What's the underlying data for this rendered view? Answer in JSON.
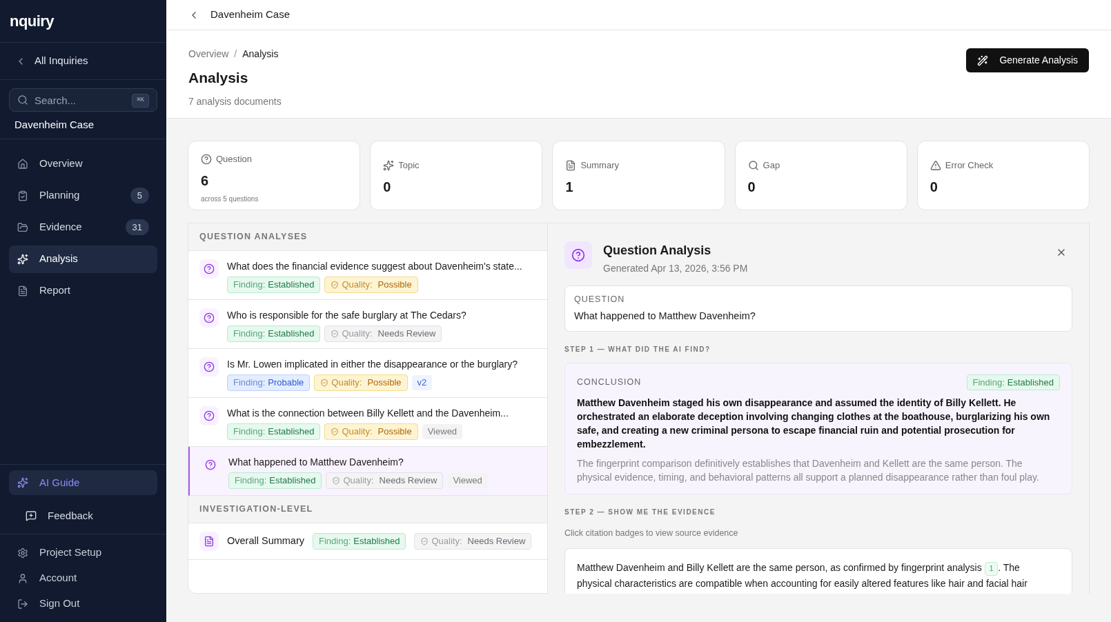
{
  "sidebar": {
    "logo": "nquiry",
    "back_link": "All Inquiries",
    "search": {
      "placeholder": "Search...",
      "shortcut": "⌘K"
    },
    "case_name": "Davenheim Case",
    "nav": [
      {
        "kind": "home",
        "label": "Overview",
        "selected": false
      },
      {
        "kind": "clipboard",
        "label": "Planning",
        "count": "5",
        "selected": false
      },
      {
        "kind": "folder",
        "label": "Evidence",
        "count": "31",
        "selected": false
      },
      {
        "kind": "sparkles",
        "label": "Analysis",
        "selected": true
      },
      {
        "kind": "file",
        "label": "Report",
        "selected": false
      }
    ],
    "ai_guide": "AI Guide",
    "feedback": "Feedback",
    "footer": [
      {
        "kind": "gear",
        "label": "Project Setup"
      },
      {
        "kind": "user",
        "label": "Account"
      },
      {
        "kind": "logout",
        "label": "Sign Out"
      }
    ]
  },
  "topbar": {
    "title": "Davenheim Case"
  },
  "header": {
    "breadcrumb": [
      "Overview",
      "Analysis"
    ],
    "breadcrumb_separator": "/",
    "title": "Analysis",
    "subtitle": "7 analysis documents",
    "action": "Generate Analysis"
  },
  "stats": [
    {
      "kind": "question",
      "label": "Question",
      "value": "6",
      "note": "across 5 questions"
    },
    {
      "kind": "sparkles",
      "label": "Topic",
      "value": "0"
    },
    {
      "kind": "file",
      "label": "Summary",
      "value": "1"
    },
    {
      "kind": "search",
      "label": "Gap",
      "value": "0"
    },
    {
      "kind": "warning",
      "label": "Error Check",
      "value": "0"
    }
  ],
  "sections": [
    {
      "heading": "QUESTION ANALYSES",
      "items": [
        {
          "kind": "question",
          "title": "What does the financial evidence suggest about Davenheim's state...",
          "selected": false,
          "finding": {
            "label": "Finding:",
            "value": "Established",
            "kind": "established"
          },
          "quality": {
            "label": "Quality:",
            "value": "Possible",
            "kind": "possible"
          }
        },
        {
          "kind": "question",
          "title": "Who is responsible for the safe burglary at The Cedars?",
          "selected": false,
          "finding": {
            "label": "Finding:",
            "value": "Established",
            "kind": "established"
          },
          "quality": {
            "label": "Quality:",
            "value": "Needs Review",
            "kind": "review"
          }
        },
        {
          "kind": "question",
          "title": "Is Mr. Lowen implicated in either the disappearance or the burglary?",
          "selected": false,
          "finding": {
            "label": "Finding:",
            "value": "Probable",
            "kind": "probable"
          },
          "quality": {
            "label": "Quality:",
            "value": "Possible",
            "kind": "possible"
          },
          "tags": [
            {
              "kind": "version",
              "text": "v2"
            }
          ]
        },
        {
          "kind": "question",
          "title": "What is the connection between Billy Kellett and the Davenheim...",
          "selected": false,
          "finding": {
            "label": "Finding:",
            "value": "Established",
            "kind": "established"
          },
          "quality": {
            "label": "Quality:",
            "value": "Possible",
            "kind": "possible"
          },
          "tags": [
            {
              "kind": "viewed",
              "text": "Viewed"
            }
          ]
        },
        {
          "kind": "question",
          "title": "What happened to Matthew Davenheim?",
          "selected": true,
          "finding": {
            "label": "Finding:",
            "value": "Established",
            "kind": "established"
          },
          "quality": {
            "label": "Quality:",
            "value": "Needs Review",
            "kind": "review"
          },
          "tags": [
            {
              "kind": "viewed",
              "text": "Viewed"
            }
          ]
        }
      ]
    },
    {
      "heading": "INVESTIGATION-LEVEL",
      "items": [
        {
          "kind": "summary",
          "title": "Overall Summary",
          "selected": false,
          "finding": {
            "label": "Finding:",
            "value": "Established",
            "kind": "established"
          },
          "quality": {
            "label": "Quality:",
            "value": "Needs Review",
            "kind": "review"
          }
        }
      ]
    }
  ],
  "detail": {
    "title": "Question Analysis",
    "generated": "Generated Apr 13, 2026, 3:56 PM",
    "question_label": "QUESTION",
    "question": "What happened to Matthew Davenheim?",
    "step1": "STEP 1 — WHAT DID THE AI FIND?",
    "conclusion_label": "CONCLUSION",
    "finding": {
      "label": "Finding:",
      "value": "Established",
      "kind": "established"
    },
    "conclusion": "Matthew Davenheim staged his own disappearance and assumed the identity of Billy Kellett. He orchestrated an elaborate deception involving changing clothes at the boathouse, burglarizing his own safe, and creating a new criminal persona to escape financial ruin and potential prosecution for embezzlement.",
    "rationale": "The fingerprint comparison definitively establishes that Davenheim and Kellett are the same person. The physical evidence, timing, and behavioral patterns all support a planned disappearance rather than foul play.",
    "step2": "STEP 2 — SHOW ME THE EVIDENCE",
    "hint": "Click citation badges to view source evidence",
    "evidence": {
      "before": "Matthew Davenheim and Billy Kellett are the same person, as confirmed by fingerprint analysis",
      "citation": "1",
      "after": ". The",
      "line2": "physical characteristics are compatible when accounting for easily altered features like hair and facial hair"
    }
  }
}
